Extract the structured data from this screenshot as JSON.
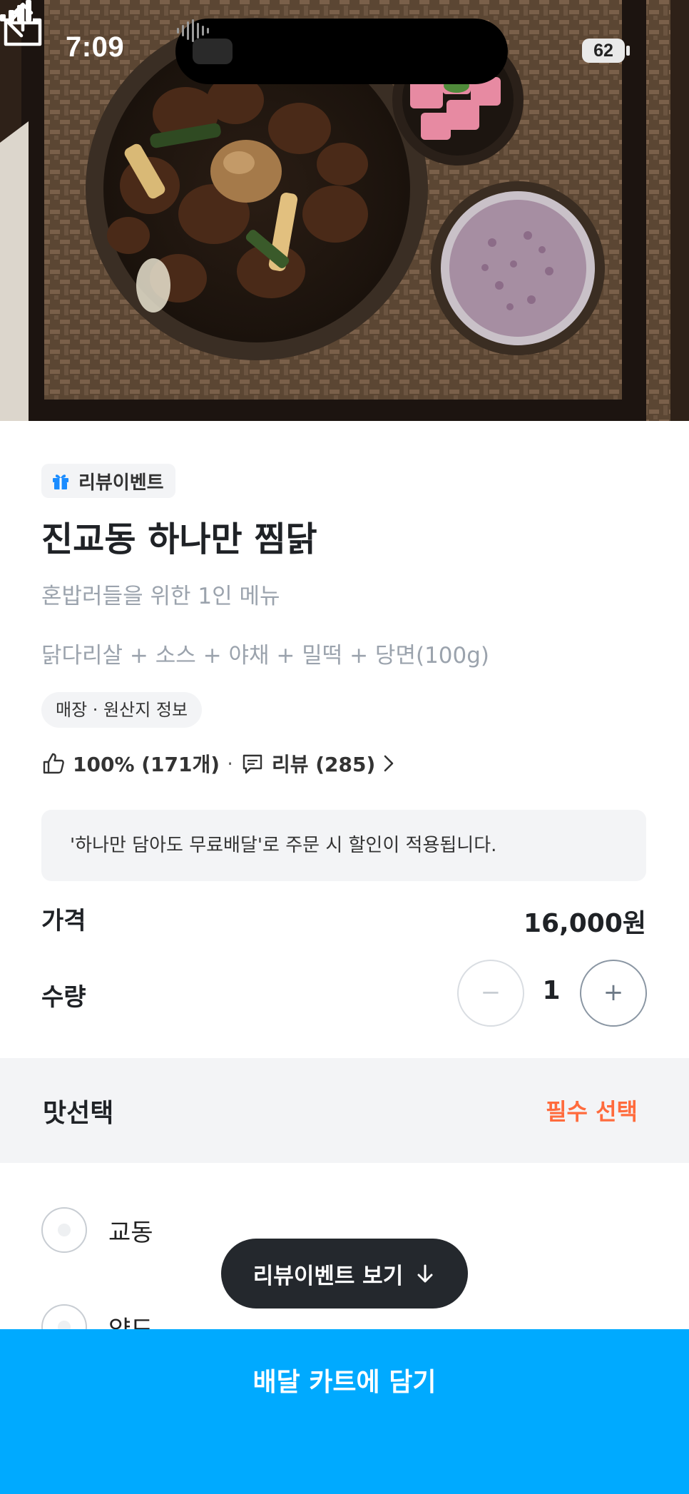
{
  "status_bar": {
    "time": "7:09",
    "battery": "62"
  },
  "nav": {
    "back_icon": "arrow-left-icon",
    "share_icon": "share-icon"
  },
  "product": {
    "event_badge": "리뷰이벤트",
    "title": "진교동 하나만 찜닭",
    "subtitle": "혼밥러들을 위한 1인 메뉴",
    "composition": "닭다리살 + 소스 + 야채 + 밀떡 + 당면(100g)",
    "origin_chip": "매장 · 원산지 정보",
    "rating": {
      "like_percent": "100% (171개)",
      "separator": "·",
      "review_label": "리뷰 (285)"
    },
    "notice": "'하나만 담아도 무료배달'로 주문 시 할인이 적용됩니다."
  },
  "price": {
    "label": "가격",
    "value": "16,000원"
  },
  "quantity": {
    "label": "수량",
    "minus": "−",
    "value": "1",
    "plus": "+"
  },
  "options": {
    "title": "맛선택",
    "required": "필수 선택",
    "items": [
      {
        "label": "교동"
      },
      {
        "label": "약도"
      }
    ]
  },
  "floating": {
    "label": "리뷰이벤트 보기"
  },
  "cart": {
    "button": "배달 카트에 담기"
  },
  "colors": {
    "accent": "#00aaff",
    "required": "#ff6b3d",
    "pill": "#24282d"
  }
}
